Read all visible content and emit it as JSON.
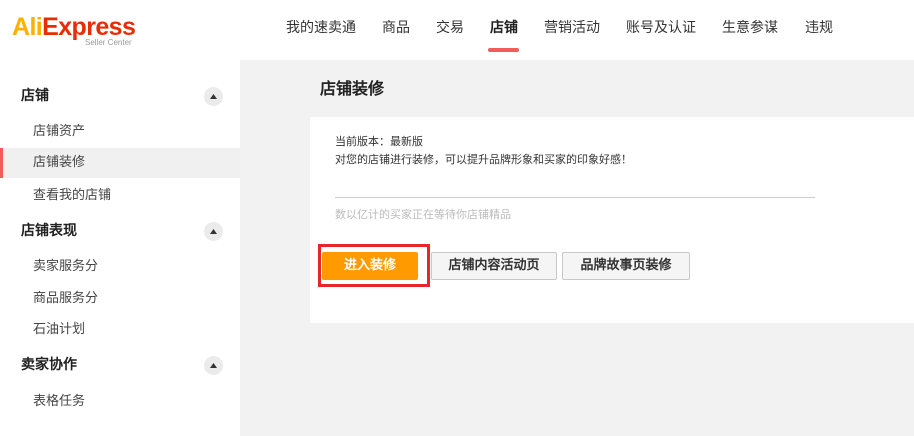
{
  "header": {
    "logo": {
      "brand_ali": "Ali",
      "brand_express": "Express",
      "subtitle": "Seller Center"
    },
    "nav": [
      {
        "label": "我的速卖通",
        "active": false
      },
      {
        "label": "商品",
        "active": false
      },
      {
        "label": "交易",
        "active": false
      },
      {
        "label": "店铺",
        "active": true
      },
      {
        "label": "营销活动",
        "active": false
      },
      {
        "label": "账号及认证",
        "active": false
      },
      {
        "label": "生意参谋",
        "active": false
      },
      {
        "label": "违规",
        "active": false
      }
    ]
  },
  "sidebar": {
    "groups": [
      {
        "title": "店铺",
        "expanded": true,
        "items": [
          {
            "label": "店铺资产",
            "active": false
          },
          {
            "label": "店铺装修",
            "active": true
          },
          {
            "label": "查看我的店铺",
            "active": false
          }
        ]
      },
      {
        "title": "店铺表现",
        "expanded": true,
        "items": [
          {
            "label": "卖家服务分",
            "active": false
          },
          {
            "label": "商品服务分",
            "active": false
          },
          {
            "label": "石油计划",
            "active": false
          }
        ]
      },
      {
        "title": "卖家协作",
        "expanded": true,
        "items": [
          {
            "label": "表格任务",
            "active": false
          }
        ]
      }
    ]
  },
  "main": {
    "title": "店铺装修",
    "version_text": "当前版本：最新版",
    "description": "对您的店铺进行装修，可以提升品牌形象和买家的印象好感！",
    "hint": "数以亿计的买家正在等待你店铺精品",
    "buttons": {
      "enter_decoration": "进入装修",
      "content_activity_page": "店铺内容活动页",
      "brand_story_page": "品牌故事页装修"
    }
  },
  "colors": {
    "brand_orange": "#ff9a00",
    "active_red": "#f45b5b",
    "highlight_red": "#e8252b"
  }
}
